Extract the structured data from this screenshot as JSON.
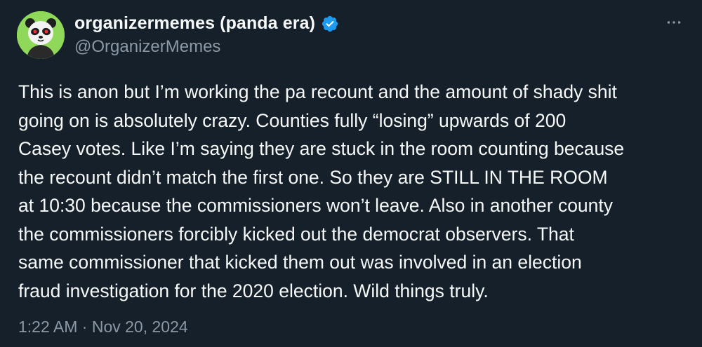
{
  "author": {
    "display_name": "organizermemes (panda era)",
    "handle": "@OrganizerMemes",
    "verified": true,
    "avatar_icon": "panda-avatar-icon",
    "avatar_bg": "#8fd85a"
  },
  "tweet": {
    "text": "This is anon but I’m working the pa recount and the amount of shady shit\ngoing on is absolutely crazy. Counties fully “losing” upwards of 200\nCasey votes. Like I’m saying they are stuck in the room counting because\nthe recount didn’t match the first one. So they are STILL IN THE ROOM\nat 10:30 because the commissioners won’t leave. Also in another county\nthe commissioners  forcibly kicked out the democrat observers. That\nsame commissioner that kicked them out was involved in an election\nfraud investigation for the 2020 election. Wild things truly.",
    "time": "1:22 AM",
    "separator": "·",
    "date": "Nov 20, 2024"
  },
  "colors": {
    "background": "#15202b",
    "text": "#f7f9f9",
    "secondary_text": "#8b98a5",
    "verified_badge": "#1d9bf0"
  },
  "icons": {
    "more": "more-horizontal-icon",
    "verified": "verified-badge-icon"
  }
}
